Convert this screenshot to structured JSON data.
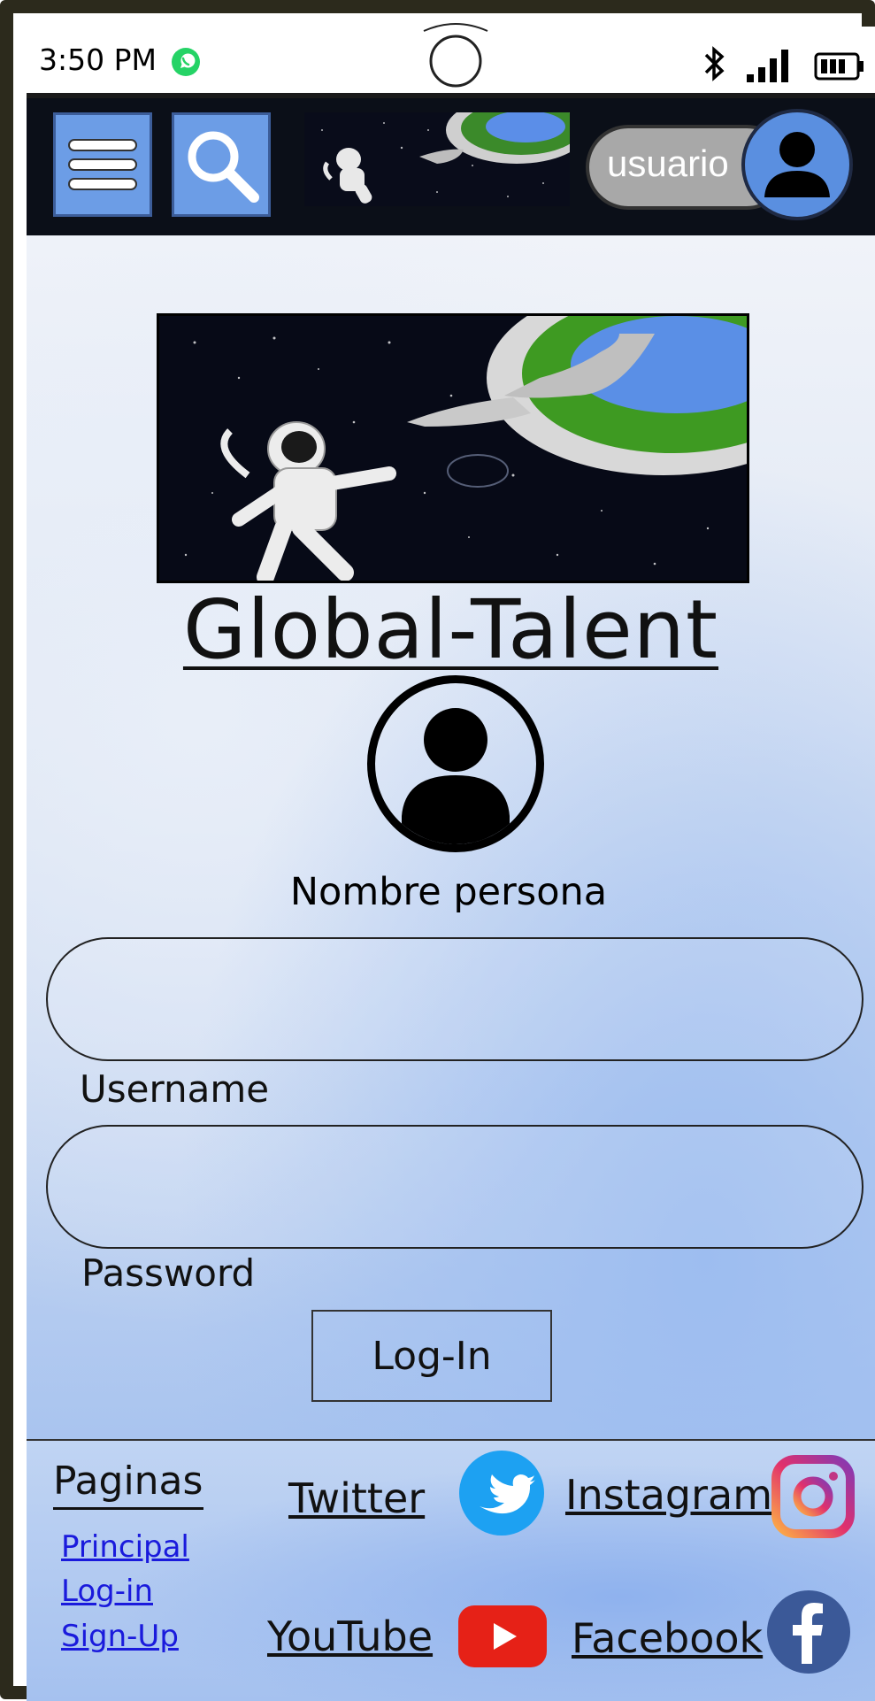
{
  "status_bar": {
    "time": "3:50 PM"
  },
  "header": {
    "user_label": "usuario",
    "icons": [
      "menu-icon",
      "search-icon",
      "user-icon"
    ]
  },
  "main": {
    "title": "Global-Talent",
    "person_name": "Nombre persona",
    "username_label": "Username",
    "password_label": "Password",
    "login_label": "Log-In"
  },
  "footer": {
    "pages_title": "Paginas",
    "links": [
      {
        "label": "Principal"
      },
      {
        "label": "Log-in"
      },
      {
        "label": "Sign-Up"
      }
    ],
    "social": {
      "twitter": "Twitter",
      "instagram": "Instagram",
      "youtube": "YouTube",
      "facebook": "Facebook"
    }
  },
  "colors": {
    "header_bg": "#0b0f18",
    "nav_button": "#6c9de6",
    "avatar_blue": "#5a8fe0",
    "link_blue": "#1a1adc",
    "twitter": "#1da1f2",
    "youtube": "#e62117",
    "facebook": "#3b5998"
  }
}
